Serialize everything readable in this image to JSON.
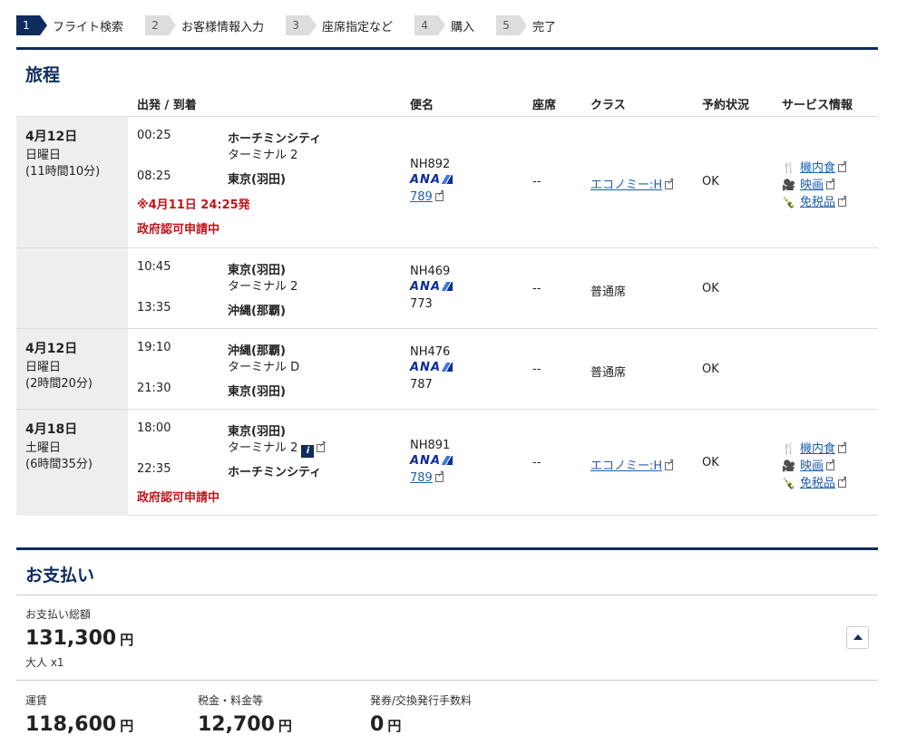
{
  "steps": [
    {
      "num": "1",
      "label": "フライト検索",
      "active": true
    },
    {
      "num": "2",
      "label": "お客様情報入力"
    },
    {
      "num": "3",
      "label": "座席指定など"
    },
    {
      "num": "4",
      "label": "購入"
    },
    {
      "num": "5",
      "label": "完了"
    }
  ],
  "itinerary": {
    "title": "旅程",
    "headers": {
      "dep_arr": "出発 / 到着",
      "flight": "便名",
      "seat": "座席",
      "class": "クラス",
      "status": "予約状況",
      "service": "サービス情報"
    },
    "days": [
      {
        "date": "4月12日",
        "weekday": "日曜日",
        "duration": "(11時間10分)"
      },
      {
        "date": "4月12日",
        "weekday": "日曜日",
        "duration": "(2時間20分)"
      },
      {
        "date": "4月18日",
        "weekday": "土曜日",
        "duration": "(6時間35分)"
      }
    ],
    "segments": [
      {
        "dep_time": "00:25",
        "dep_city": "ホーチミンシティ",
        "dep_terminal": "ターミナル 2",
        "arr_time": "08:25",
        "arr_city": "東京(羽田)",
        "note": "※4月11日 24:25発",
        "approval": "政府認可申請中",
        "flight_no": "NH892",
        "airline": "ANA",
        "aircraft": "789",
        "seat": "--",
        "class": "エコノミー:H",
        "status": "OK",
        "services": [
          "機内食",
          "映画",
          "免税品"
        ]
      },
      {
        "dep_time": "10:45",
        "dep_city": "東京(羽田)",
        "dep_terminal": "ターミナル 2",
        "arr_time": "13:35",
        "arr_city": "沖縄(那覇)",
        "flight_no": "NH469",
        "airline": "ANA",
        "aircraft": "773",
        "seat": "--",
        "class": "普通席",
        "status": "OK"
      },
      {
        "dep_time": "19:10",
        "dep_city": "沖縄(那覇)",
        "dep_terminal": "ターミナル D",
        "arr_time": "21:30",
        "arr_city": "東京(羽田)",
        "flight_no": "NH476",
        "airline": "ANA",
        "aircraft": "787",
        "seat": "--",
        "class": "普通席",
        "status": "OK"
      },
      {
        "dep_time": "18:00",
        "dep_city": "東京(羽田)",
        "dep_terminal": "ターミナル 2",
        "arr_time": "22:35",
        "arr_city": "ホーチミンシティ",
        "approval": "政府認可申請中",
        "flight_no": "NH891",
        "airline": "ANA",
        "aircraft": "789",
        "seat": "--",
        "class": "エコノミー:H",
        "status": "OK",
        "services": [
          "機内食",
          "映画",
          "免税品"
        ]
      }
    ]
  },
  "payment": {
    "title": "お支払い",
    "total_label": "お支払い総額",
    "total_value": "131,300",
    "currency": "円",
    "passengers": "大人 x1",
    "items": [
      {
        "label": "運賃",
        "value": "118,600"
      },
      {
        "label": "税金・料金等",
        "value": "12,700"
      },
      {
        "label": "発券/交換発行手数料",
        "value": "0"
      }
    ]
  },
  "colors": {
    "brand": "#0e2c5c",
    "link": "#1e5fad",
    "alert": "#c0151b"
  }
}
